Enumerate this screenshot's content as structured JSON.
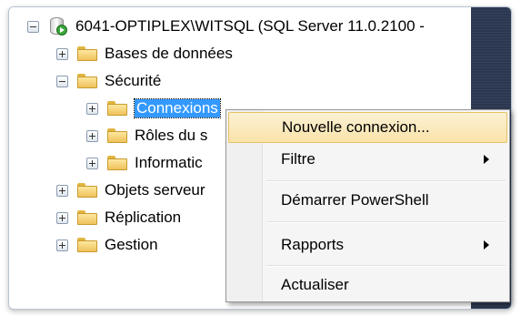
{
  "tree": {
    "server_label": "6041-OPTIPLEX\\WITSQL (SQL Server 11.0.2100 -",
    "items": [
      {
        "label": "Bases de données"
      },
      {
        "label": "Sécurité"
      },
      {
        "label": "Connexions"
      },
      {
        "label": "Rôles du s"
      },
      {
        "label": "Informatic"
      },
      {
        "label": "Objets serveur"
      },
      {
        "label": "Réplication"
      },
      {
        "label": "Gestion"
      }
    ]
  },
  "context_menu": {
    "items": [
      {
        "label": "Nouvelle connexion..."
      },
      {
        "label": "Filtre"
      },
      {
        "label": "Démarrer PowerShell"
      },
      {
        "label": "Rapports"
      },
      {
        "label": "Actualiser"
      }
    ]
  },
  "colors": {
    "selection": "#3399ff",
    "menu_hover": "#f9e3aa",
    "side_panel": "#2b3750"
  }
}
